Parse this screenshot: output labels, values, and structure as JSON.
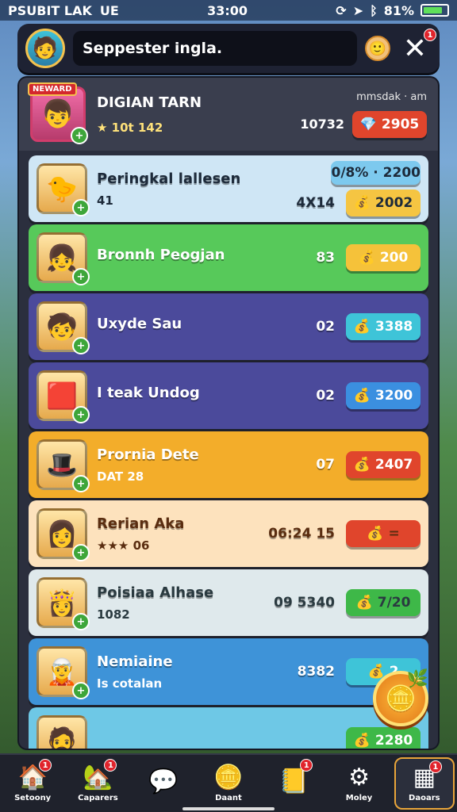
{
  "status_bar": {
    "left_text": "PSUBIT LAK",
    "carrier_icon": "UE",
    "time": "33:00",
    "battery_text": "81%",
    "battery_level": 0.81
  },
  "top_bar": {
    "search_text": "Seppester ingla.",
    "close_label": "✕",
    "close_badge": "1"
  },
  "player": {
    "tag": "NEWARD",
    "name": "DIGIAN TARN",
    "level_text": "10t 142",
    "label": "mmsdak · am",
    "score": "10732",
    "reward": "2905"
  },
  "rows": [
    {
      "name": "Peringkal lallesen",
      "sub": "41",
      "top_pill": "0/8% · 2200",
      "number": "4X14",
      "pill": "2002",
      "color": "#cfe6f5",
      "pill_color": "#f5c542",
      "text_color": "#1d2a3a"
    },
    {
      "name": "Bronnh Peogjan",
      "sub": "",
      "number": "83",
      "pill": "200",
      "color": "#57c95a",
      "pill_color": "#f5c23a",
      "text_color": "#ffffff"
    },
    {
      "name": "Uxyde Sau",
      "sub": "",
      "number": "02",
      "pill": "3388",
      "color": "#4b4a9b",
      "pill_color": "#3ec4d8",
      "text_color": "#ffffff"
    },
    {
      "name": "I teak Undog",
      "sub": "",
      "number": "02",
      "pill": "3200",
      "color": "#4b4a9b",
      "pill_color": "#3b8fe0",
      "text_color": "#ffffff"
    },
    {
      "name": "Prornia Dete",
      "sub": "DAT 28",
      "number": "07",
      "pill": "2407",
      "color": "#f3ad2a",
      "pill_color": "#e0452c",
      "text_color": "#ffffff"
    },
    {
      "name": "Rerian Aka",
      "sub": "★★★ 06",
      "number": "06:24 15",
      "pill": "=",
      "color": "#fde2bd",
      "pill_color": "#e0452c",
      "text_color": "#5a2d10"
    },
    {
      "name": "Poisiaa Alhase",
      "sub": "1082",
      "number": "09 5340",
      "pill": "7/20",
      "color": "#dfe9ec",
      "pill_color": "#3eb848",
      "text_color": "#2a3a40"
    },
    {
      "name": "Nemiaine",
      "sub": "Is cotalan",
      "number": "8382",
      "pill": "2",
      "color": "#3e93d8",
      "pill_color": "#3ec4d8",
      "text_color": "#ffffff"
    },
    {
      "name": "",
      "sub": "",
      "number": "",
      "pill": "2280",
      "color": "#6ec8e6",
      "pill_color": "#3eb848",
      "text_color": "#ffffff"
    }
  ],
  "tabs": [
    {
      "label": "Setoony",
      "icon": "home-icon",
      "badge": "1"
    },
    {
      "label": "Caparers",
      "icon": "house-icon",
      "badge": "1"
    },
    {
      "label": "",
      "icon": "chat-icon",
      "badge": ""
    },
    {
      "label": "Daant",
      "icon": "coin-icon",
      "badge": ""
    },
    {
      "label": "",
      "icon": "notes-icon",
      "badge": "1"
    },
    {
      "label": "Moley",
      "icon": "gear-icon",
      "badge": ""
    },
    {
      "label": "Daoars",
      "icon": "grid-icon",
      "badge": "1"
    }
  ]
}
